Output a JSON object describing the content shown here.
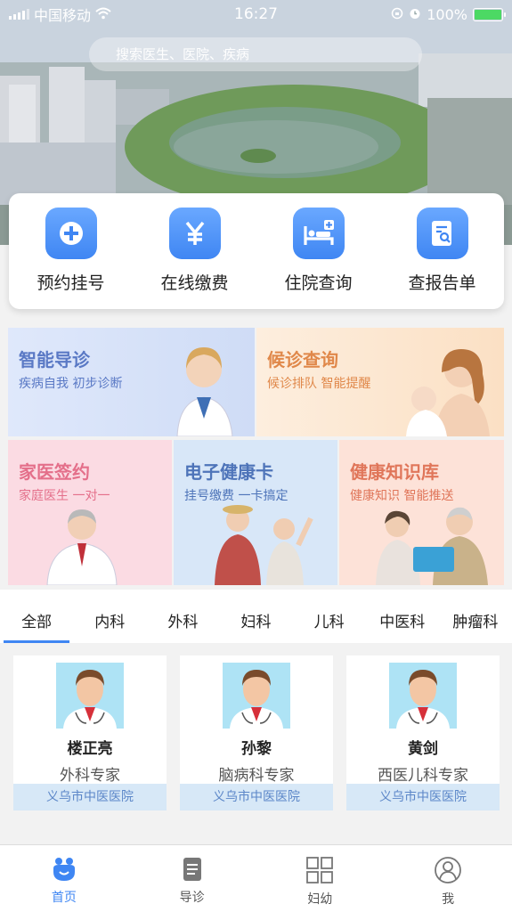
{
  "status_bar": {
    "carrier": "中国移动",
    "time": "16:27",
    "battery": "100%"
  },
  "search": {
    "placeholder": "搜索医生、医院、疾病"
  },
  "quick_actions": [
    {
      "label": "预约挂号",
      "icon": "plus-circle-icon"
    },
    {
      "label": "在线缴费",
      "icon": "yuan-icon"
    },
    {
      "label": "住院查询",
      "icon": "hospital-bed-icon"
    },
    {
      "label": "查报告单",
      "icon": "report-search-icon"
    }
  ],
  "services": [
    {
      "title": "智能导诊",
      "subtitle": "疾病自我 初步诊断"
    },
    {
      "title": "候诊查询",
      "subtitle": "候诊排队 智能提醒"
    },
    {
      "title": "家医签约",
      "subtitle": "家庭医生 一对一"
    },
    {
      "title": "电子健康卡",
      "subtitle": "挂号缴费 一卡搞定"
    },
    {
      "title": "健康知识库",
      "subtitle": "健康知识 智能推送"
    }
  ],
  "tabs": [
    "全部",
    "内科",
    "外科",
    "妇科",
    "儿科",
    "中医科",
    "肿瘤科"
  ],
  "doctors": [
    {
      "name": "楼正亮",
      "title": "外科专家",
      "hospital": "义乌市中医医院"
    },
    {
      "name": "孙黎",
      "title": "脑病科专家",
      "hospital": "义乌市中医医院"
    },
    {
      "name": "黄剑",
      "title": "西医儿科专家",
      "hospital": "义乌市中医医院"
    }
  ],
  "bottom_nav": [
    {
      "label": "首页",
      "active": true
    },
    {
      "label": "导诊",
      "active": false
    },
    {
      "label": "妇幼",
      "active": false
    },
    {
      "label": "我",
      "active": false
    }
  ],
  "colors": {
    "accent": "#3f86f3",
    "battery": "#4cd964"
  }
}
